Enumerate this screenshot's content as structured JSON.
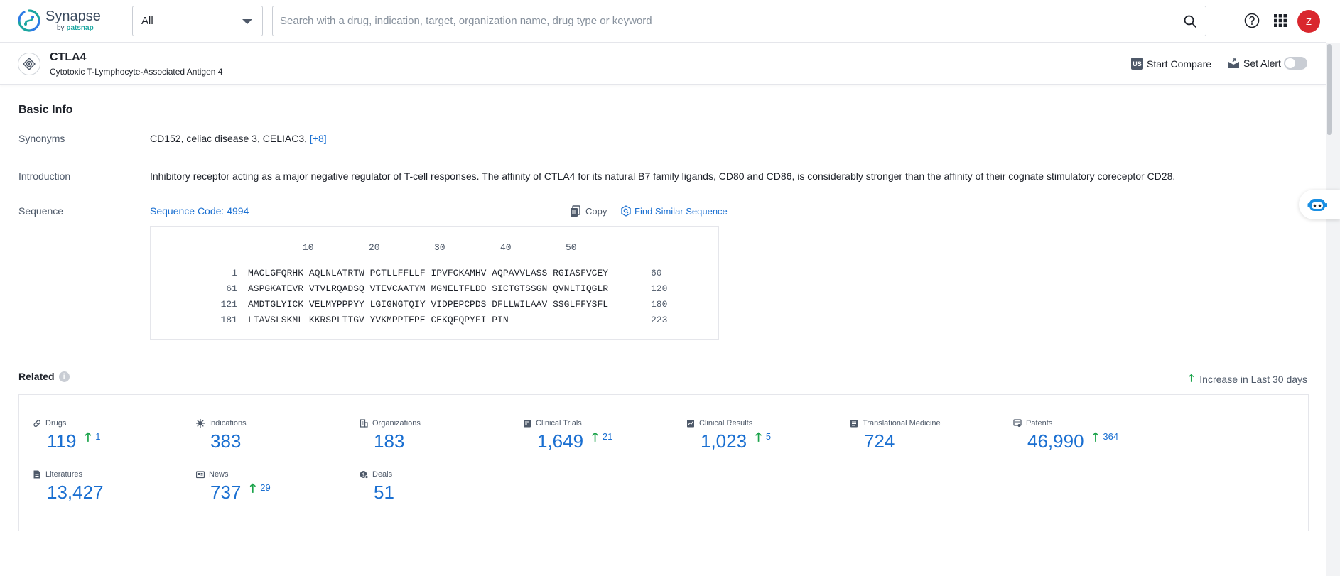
{
  "app": {
    "logo_name": "Synapse",
    "logo_by": "by",
    "logo_brand": "patsnap"
  },
  "nav": {
    "scope_selected": "All",
    "search_placeholder": "Search with a drug, indication, target, organization name, drug type or keyword",
    "avatar_initial": "Z"
  },
  "target": {
    "name": "CTLA4",
    "full_name": "Cytotoxic T-Lymphocyte-Associated Antigen 4",
    "compare_icon": "US",
    "compare_label": "Start Compare",
    "alert_label": "Set Alert",
    "alert_enabled": false
  },
  "basic_info": {
    "title": "Basic Info",
    "synonyms_label": "Synonyms",
    "synonyms_text": "CD152,  celiac disease 3,  CELIAC3,",
    "synonyms_more": "[+8]",
    "introduction_label": "Introduction",
    "introduction_text": "Inhibitory receptor acting as a major negative regulator of T-cell responses. The affinity of CTLA4 for its natural B7 family ligands, CD80 and CD86, is considerably stronger than the affinity of their cognate stimulatory coreceptor CD28.",
    "sequence_label": "Sequence",
    "sequence_code": "Sequence Code: 4994",
    "copy_label": "Copy",
    "find_similar_label": "Find Similar Sequence",
    "ruler": [
      "10",
      "20",
      "30",
      "40",
      "50"
    ],
    "sequence_rows": [
      {
        "start": "1",
        "seq": "MACLGFQRHK AQLNLATRTW PCTLLFFLLF IPVFCKAMHV AQPAVVLASS RGIASFVCEY",
        "end": "60"
      },
      {
        "start": "61",
        "seq": "ASPGKATEVR VTVLRQADSQ VTEVCAATYM MGNELTFLDD SICTGTSSGN QVNLTIQGLR",
        "end": "120"
      },
      {
        "start": "121",
        "seq": "AMDTGLYICK VELMYPPPYY LGIGNGTQIY VIDPEPCPDS DFLLWILAAV SSGLFFYSFL",
        "end": "180"
      },
      {
        "start": "181",
        "seq": "LTAVSLSKML KKRSPLTTGV YVKMPPTEPE CEKQFQPYFI PIN",
        "end": "223"
      }
    ]
  },
  "related": {
    "title": "Related",
    "info_icon": "i",
    "increase_note": "Increase in Last 30 days",
    "stats": [
      {
        "label": "Drugs",
        "value": "119",
        "increase": "1",
        "icon": "pill-icon"
      },
      {
        "label": "Indications",
        "value": "383",
        "increase": "",
        "icon": "virus-icon"
      },
      {
        "label": "Organizations",
        "value": "183",
        "increase": "",
        "icon": "building-icon"
      },
      {
        "label": "Clinical Trials",
        "value": "1,649",
        "increase": "21",
        "icon": "clipboard-icon"
      },
      {
        "label": "Clinical Results",
        "value": "1,023",
        "increase": "5",
        "icon": "results-icon"
      },
      {
        "label": "Translational Medicine",
        "value": "724",
        "increase": "",
        "icon": "medicine-icon"
      },
      {
        "label": "Patents",
        "value": "46,990",
        "increase": "364",
        "icon": "patent-icon"
      },
      {
        "label": "Literatures",
        "value": "13,427",
        "increase": "",
        "icon": "document-icon"
      },
      {
        "label": "News",
        "value": "737",
        "increase": "29",
        "icon": "news-icon"
      },
      {
        "label": "Deals",
        "value": "51",
        "increase": "",
        "icon": "deal-icon"
      }
    ]
  },
  "colors": {
    "accent_blue": "#1a6fd1",
    "increase_green": "#1aa34a",
    "avatar_red": "#d9272e",
    "brand_teal": "#1ba6a0"
  }
}
